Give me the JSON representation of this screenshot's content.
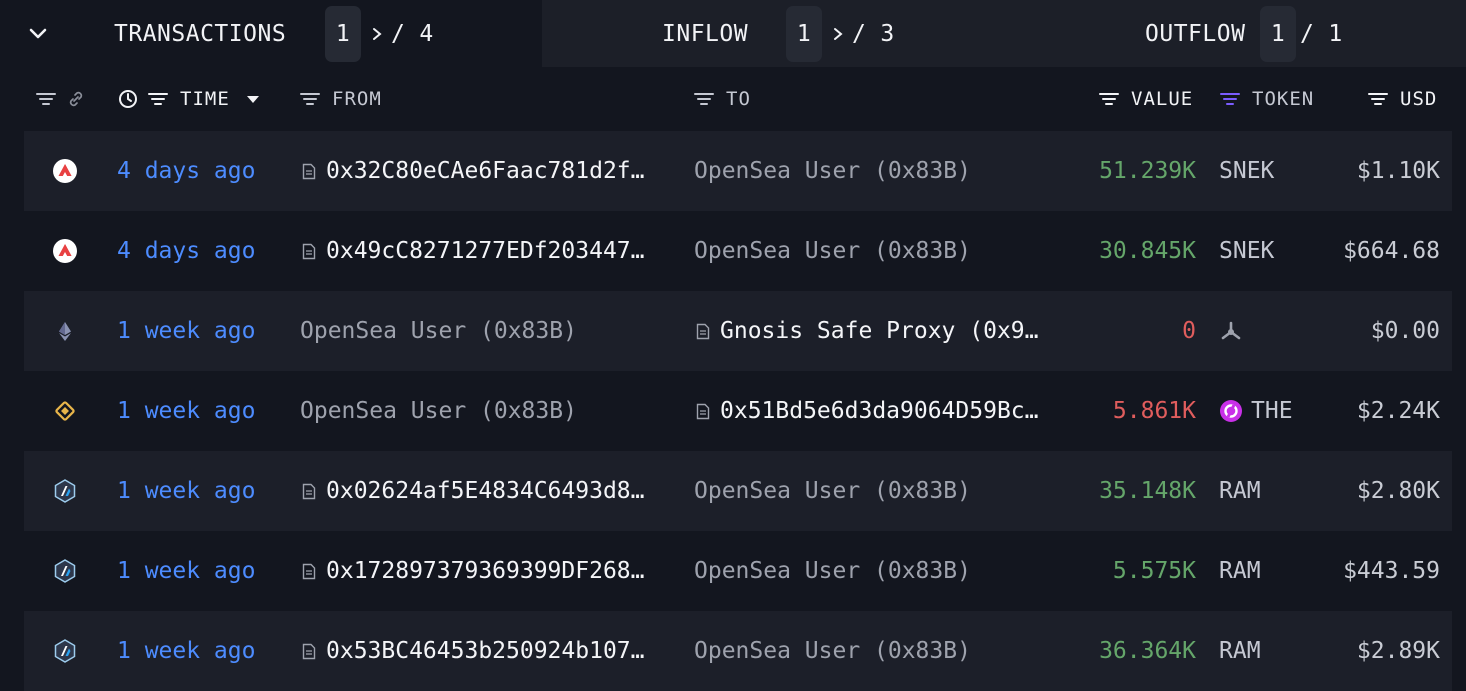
{
  "tabs": {
    "transactions": {
      "label": "TRANSACTIONS",
      "page": "1",
      "total": "4"
    },
    "inflow": {
      "label": "INFLOW",
      "page": "1",
      "total": "3"
    },
    "outflow": {
      "label": "OUTFLOW",
      "page": "1",
      "total": "1"
    }
  },
  "columns": {
    "time": "TIME",
    "from": "FROM",
    "to": "TO",
    "value": "VALUE",
    "token": "TOKEN",
    "usd": "USD"
  },
  "colors": {
    "time": "#4d8cff",
    "inflow_value": "#65a66a",
    "outflow_value": "#e05d5d",
    "token_filter_active": "#7b5cff"
  },
  "rows": [
    {
      "chain": "avalanche-icon",
      "time": "4 days ago",
      "from": "0x32C80eCAe6Faac781d2f…",
      "from_contract": true,
      "to": "OpenSea User (0x83B)",
      "to_contract": false,
      "value": "51.239K",
      "direction": "in",
      "token": "SNEK",
      "token_icon": "",
      "usd": "$1.10K"
    },
    {
      "chain": "avalanche-icon",
      "time": "4 days ago",
      "from": "0x49cC8271277EDf203447…",
      "from_contract": true,
      "to": "OpenSea User (0x83B)",
      "to_contract": false,
      "value": "30.845K",
      "direction": "in",
      "token": "SNEK",
      "token_icon": "",
      "usd": "$664.68"
    },
    {
      "chain": "ethereum-icon",
      "time": "1 week ago",
      "from": "OpenSea User (0x83B)",
      "from_contract": false,
      "to": "Gnosis Safe Proxy (0x9…",
      "to_contract": true,
      "value": "0",
      "direction": "out",
      "token": "",
      "token_icon": "unknown-token-icon",
      "usd": "$0.00"
    },
    {
      "chain": "bsc-icon",
      "time": "1 week ago",
      "from": "OpenSea User (0x83B)",
      "from_contract": false,
      "to": "0x51Bd5e6d3da9064D59Bc…",
      "to_contract": true,
      "value": "5.861K",
      "direction": "out",
      "token": "THE",
      "token_icon": "the-token-icon",
      "usd": "$2.24K"
    },
    {
      "chain": "arbitrum-icon",
      "time": "1 week ago",
      "from": "0x02624af5E4834C6493d8…",
      "from_contract": true,
      "to": "OpenSea User (0x83B)",
      "to_contract": false,
      "value": "35.148K",
      "direction": "in",
      "token": "RAM",
      "token_icon": "",
      "usd": "$2.80K"
    },
    {
      "chain": "arbitrum-icon",
      "time": "1 week ago",
      "from": "0x172897379369399DF268…",
      "from_contract": true,
      "to": "OpenSea User (0x83B)",
      "to_contract": false,
      "value": "5.575K",
      "direction": "in",
      "token": "RAM",
      "token_icon": "",
      "usd": "$443.59"
    },
    {
      "chain": "arbitrum-icon",
      "time": "1 week ago",
      "from": "0x53BC46453b250924b107…",
      "from_contract": true,
      "to": "OpenSea User (0x83B)",
      "to_contract": false,
      "value": "36.364K",
      "direction": "in",
      "token": "RAM",
      "token_icon": "",
      "usd": "$2.89K"
    }
  ]
}
